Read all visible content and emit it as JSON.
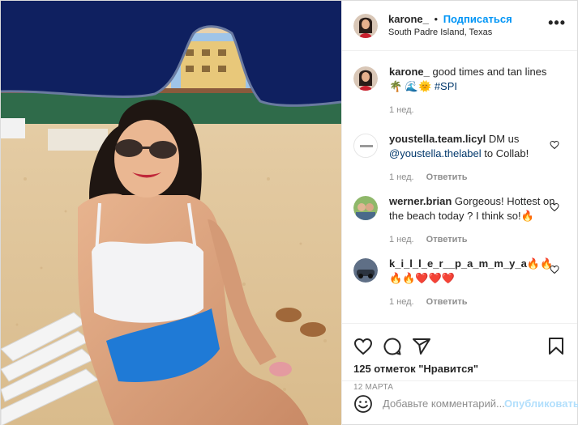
{
  "colors": {
    "accent": "#0095f6",
    "link": "#00376b",
    "muted": "#8e8e8e",
    "like_red": "#ed4956"
  },
  "header": {
    "username": "karone_",
    "separator": "•",
    "follow_label": "Подписаться",
    "location": "South Padre Island, Texas",
    "more_label": "•••"
  },
  "caption": {
    "username": "karone_",
    "text": " good times and tan lines 🌴",
    "line2_emoji": "🌊🌞 ",
    "hashtag": "#SPI",
    "time": "1 нед."
  },
  "comments": [
    {
      "username": "youstella.team.licyl",
      "text": " DM us ",
      "mention": "@youstella.thelabel",
      "text2": " to Collab!",
      "time": "1 нед.",
      "reply_label": "Ответить",
      "avatar_icon": "brand-logo-avatar"
    },
    {
      "username": "werner.brian",
      "text": " Gorgeous! Hottest on the beach today ? I think so!🔥",
      "time": "1 нед.",
      "reply_label": "Ответить",
      "avatar_icon": "couple-photo-avatar"
    },
    {
      "username": "k_i_l_l_e_r__p_a_m_m_y_a",
      "text": "🔥🔥 🔥🔥❤️❤️❤️",
      "time": "1 нед.",
      "reply_label": "Ответить",
      "avatar_icon": "car-photo-avatar"
    }
  ],
  "actions": {
    "icons": [
      "heart-icon",
      "comment-icon",
      "share-icon",
      "bookmark-icon"
    ],
    "likes_label": "125 отметок \"Нравится\"",
    "date_label": "12 МАРТА"
  },
  "add_comment": {
    "placeholder": "Добавьте комментарий...",
    "publish_label": "Опубликовать",
    "icon": "smile-icon"
  },
  "photo": {
    "scene": "beach-photo"
  }
}
